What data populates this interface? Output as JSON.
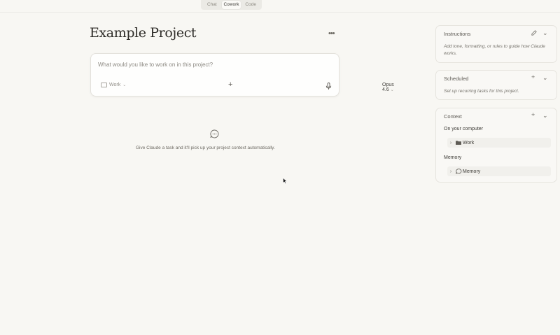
{
  "tabs": [
    "Chat",
    "Cowork",
    "Code"
  ],
  "active_tab": "Cowork",
  "project": {
    "title": "Example Project",
    "more_icon": "more-horizontal-icon"
  },
  "composer": {
    "placeholder": "What would you like to work on in this project?",
    "value": "",
    "folder_label": "Work",
    "model_label": "Opus 4.6"
  },
  "empty_state": {
    "text": "Give Claude a task and it'll pick up your project context automatically."
  },
  "instructions": {
    "title": "Instructions",
    "description": "Add tone, formatting, or rules to guide how Claude works."
  },
  "scheduled": {
    "title": "Scheduled",
    "description": "Set up recurring tasks for this project."
  },
  "context": {
    "title": "Context",
    "computer_heading": "On your computer",
    "computer_item": "Work",
    "memory_heading": "Memory",
    "memory_item": "Memory"
  },
  "colors": {
    "background": "#f8f7f3",
    "panel": "#f9f8f5",
    "border": "#e6e4de"
  }
}
